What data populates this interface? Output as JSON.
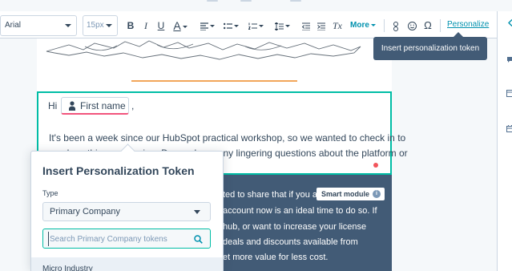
{
  "toolbar": {
    "font_family": "Arial",
    "font_size": "15px",
    "bold": "B",
    "italic": "I",
    "underline": "U",
    "text_color": "A",
    "clear_format": "Tx",
    "more_label": "More",
    "personalize_label": "Personalize",
    "link_icon": "link-icon",
    "emoji_icon": "emoji-icon",
    "omega_icon": "special-character-icon"
  },
  "tooltip": {
    "text": "Insert personalization token"
  },
  "email": {
    "greeting": "Hi",
    "token_label": "First name",
    "comma": ",",
    "paragraph_lines": [
      "It's been a week since our HubSpot practical workshop, so we wanted to check in to",
      "see how things are going. Do you have any lingering questions about the platform or"
    ],
    "dark_lines": [
      "ted to share that if you a",
      "account now is an ideal time to do so. If",
      "hub, or want to increase your license",
      "deals and discounts available from",
      "et more value for less cost."
    ],
    "smart_module_label": "Smart module",
    "info_glyph": "i"
  },
  "popover": {
    "title": "Insert Personalization Token",
    "type_label": "Type",
    "type_value": "Primary Company",
    "search_placeholder": "Search Primary Company tokens",
    "first_item": "Micro Industry"
  },
  "colors": {
    "accent_teal": "#00bda5",
    "link_blue": "#0091ae",
    "dark_slate": "#425b76",
    "orange_rule": "#f2a65a",
    "token_pink": "#f2547d"
  }
}
